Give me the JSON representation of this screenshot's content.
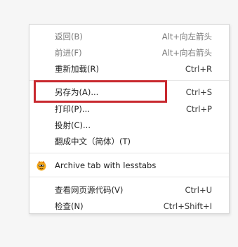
{
  "context_menu": {
    "items": [
      {
        "label": "返回(B)",
        "shortcut": "Alt+向左箭头",
        "disabled": true
      },
      {
        "label": "前进(F)",
        "shortcut": "Alt+向右箭头",
        "disabled": true
      },
      {
        "label": "重新加载(R)",
        "shortcut": "Ctrl+R",
        "disabled": false
      },
      {
        "label": "另存为(A)...",
        "shortcut": "Ctrl+S",
        "disabled": false
      },
      {
        "label": "打印(P)...",
        "shortcut": "Ctrl+P",
        "disabled": false
      },
      {
        "label": "投射(C)...",
        "shortcut": "",
        "disabled": false
      },
      {
        "label": "翻成中文（简体）(T)",
        "shortcut": "",
        "disabled": false
      },
      {
        "label": "Archive tab with lesstabs",
        "shortcut": "",
        "icon": "lesstabs-extension-icon"
      },
      {
        "label": "查看网页源代码(V)",
        "shortcut": "Ctrl+U",
        "disabled": false
      },
      {
        "label": "检查(N)",
        "shortcut": "Ctrl+Shift+I",
        "disabled": false
      }
    ]
  },
  "colors": {
    "highlight_border": "#c8282e",
    "menu_background": "#ffffff",
    "disabled_text": "#7a7a7a"
  }
}
